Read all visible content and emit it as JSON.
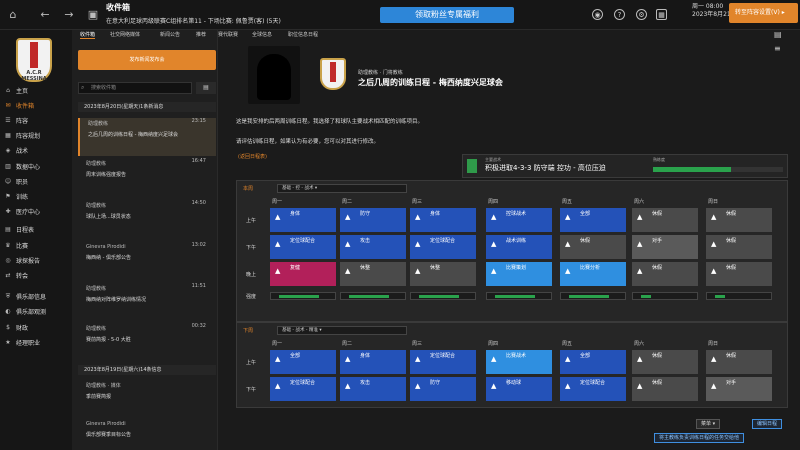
{
  "top": {
    "title": "收件箱",
    "subtitle": "在意大利足球丙级联赛C组排名第11 - 下场比赛: 佩鲁贾(客) (5天)",
    "promo": "领取粉丝专属福利",
    "date_line1": "周一 08:00",
    "date_line2": "2023年8月21日",
    "continue_label": "转至阵容设置(V)"
  },
  "sidebar": {
    "club_crest_text": "A.C.R MESSINA",
    "items": [
      {
        "label": "主页",
        "icon": "home-icon"
      },
      {
        "label": "收件箱",
        "icon": "inbox-icon",
        "active": true
      },
      {
        "label": "阵容",
        "icon": "squad-icon"
      },
      {
        "label": "阵容规划",
        "icon": "planner-icon"
      },
      {
        "label": "战术",
        "icon": "tactics-icon"
      },
      {
        "label": "数据中心",
        "icon": "data-icon"
      },
      {
        "label": "职员",
        "icon": "staff-icon"
      },
      {
        "label": "训练",
        "icon": "training-icon"
      },
      {
        "label": "医疗中心",
        "icon": "medical-icon"
      },
      {
        "label": "日程表",
        "icon": "calendar-icon"
      },
      {
        "label": "比赛",
        "icon": "trophy-icon"
      },
      {
        "label": "球探报告",
        "icon": "scout-icon"
      },
      {
        "label": "转会",
        "icon": "transfer-icon"
      },
      {
        "label": "俱乐部信息",
        "icon": "club-icon"
      },
      {
        "label": "俱乐部观测",
        "icon": "vision-icon"
      },
      {
        "label": "财政",
        "icon": "finance-icon"
      },
      {
        "label": "经理职业",
        "icon": "career-icon"
      }
    ]
  },
  "tabs": [
    "收件箱",
    "社交网络媒体",
    "新闻公告",
    "推荐",
    "赛代联赛",
    "全球信息",
    "职位信息日程"
  ],
  "inbox": {
    "new_button": "发布新闻发布会",
    "search_placeholder": "搜索收件箱",
    "groups": [
      "2023年8月20日(星期天)1条新消息",
      "2023年8月19日(星期六)14条信息"
    ],
    "messages": [
      {
        "from": "助理教练",
        "time": "23:15",
        "body": "之后几周的训练日程 - 梅西纳度兴足球会",
        "selected": true
      },
      {
        "from": "助理教练",
        "time": "16:47",
        "body": "周末训练强度报告"
      },
      {
        "from": "助理教练",
        "time": "14:50",
        "body": "球队上场...球员状态"
      },
      {
        "from": "Ginevra Pirodidi",
        "time": "13:02",
        "body": "梅西纳 - 俱乐部公告"
      },
      {
        "from": "助理教练",
        "time": "11:51",
        "body": "梅西纳对阵维罗纳训练情况"
      },
      {
        "from": "助理教练",
        "time": "00:32",
        "body": "赛前简报 - 5-0 大胜"
      },
      {
        "from": "助理教练 · 媒体",
        "time": "",
        "body": "季前赛简报"
      },
      {
        "from": "Ginevra Pirodidi",
        "time": "",
        "body": "俱乐部赛季目标公告"
      }
    ]
  },
  "email": {
    "sender": "助理教练 · 门将教练",
    "subject": "之后几周的训练日程 - 梅西纳度兴足球会",
    "p1": "这是我安排的后两周训练日程。我选择了和球队主要战术相匹配的训练项目。",
    "p2": "请评估训练日程，如果认为有必要，您可以对其进行修改。",
    "back_link": "(返回日程表)",
    "tactic_label": "主要战术",
    "tactic_value": "积极进取4-3-3 防守端 控功 - 高位压迫",
    "intensity_label": "熟练度",
    "intensity_fill": 0.6
  },
  "schedule": {
    "week1_label": "本周",
    "week1_drop": "基础 - 控 - 战术",
    "week2_label": "下周",
    "week2_drop": "基础 - 战术 - 精准",
    "days": [
      "周一",
      "周二",
      "周三",
      "周四",
      "周五",
      "周六",
      "周日"
    ],
    "row_labels": [
      "上午",
      "下午",
      "晚上",
      "强度"
    ],
    "week1": [
      [
        "身体",
        "防守",
        "身体",
        "控球战术",
        "全部",
        "休假",
        "休假"
      ],
      [
        "定位球配合",
        "攻击",
        "定位球配合",
        "战术训练",
        "休假",
        "对手",
        "休假"
      ],
      [
        "复健",
        "休整",
        "休整",
        "比赛策划",
        "比赛分析",
        "休假",
        "休假"
      ]
    ],
    "week2": [
      [
        "全部",
        "身体",
        "定位球配合",
        "比赛战术",
        "全部",
        "休假",
        "休假"
      ],
      [
        "定位球配合",
        "攻击",
        "防守",
        "移动球",
        "定位球配合",
        "休假",
        "对手"
      ]
    ]
  },
  "footer": {
    "menu_label": "菜单",
    "apply_btn": "编辑日程",
    "auto_btn": "将主教练负责训练日程的任务交给他"
  }
}
